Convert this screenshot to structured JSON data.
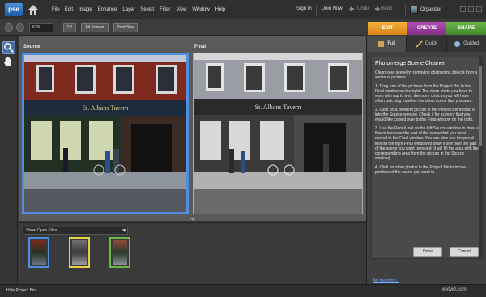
{
  "app": {
    "logo": "pse"
  },
  "menu": [
    "File",
    "Edit",
    "Image",
    "Enhance",
    "Layer",
    "Select",
    "Filter",
    "View",
    "Window",
    "Help"
  ],
  "account": {
    "sign_in": "Sign In",
    "join_now": "Join Now"
  },
  "history": {
    "undo": "Undo",
    "redo": "Redo"
  },
  "organizer": "Organizer",
  "mode_tabs": [
    "EDIT",
    "CREATE",
    "SHARE"
  ],
  "options": {
    "zoom": "67%",
    "one_to_one": "1:1",
    "fit_screen": "Fit Screen",
    "print_size": "Print Size"
  },
  "workspace": {
    "source_label": "Source",
    "final_label": "Final"
  },
  "bin": {
    "dropdown": "Show Open Files"
  },
  "bottom": {
    "hide_bin": "Hide Project Bin"
  },
  "panel": {
    "subtabs": [
      "Full",
      "Quick",
      "Guided"
    ],
    "title": "Photomerge Scene Cleaner",
    "paragraphs": [
      "Clean your scene by removing obstructing objects from a series of pictures.",
      "1. Drag one of the pictures from the Project Bin to the Final window on the right. The more shots you have to work with (up to ten), the more choices you will have when patching together the clean scene that you want.",
      "2. Click on a different picture in the Project Bin to load it into the Source window. Check it for scenery that you would like copied over to the Final window on the right.",
      "3. Use the Pencil tool on the left Source window to draw a line or two over the part of the scene that you want moved to the Final window. You can also use the pencil tool on the right Final window to draw a line over the part of the scene you want removed (it will fill the area with the corresponding area from the picture in the Source window).",
      "4. Click on other photos in the Project Bin to locate portions of the scene you want to"
    ],
    "done": "Done",
    "cancel": "Cancel",
    "tell_me": "Tell me more..."
  },
  "pub_sign": "St. Albans Tavern",
  "watermark": "wvtvid.com",
  "colors": {
    "edit": "#e89a2a",
    "create": "#9a3fa0",
    "share": "#57a03a",
    "selection": "#4f8ee3"
  }
}
